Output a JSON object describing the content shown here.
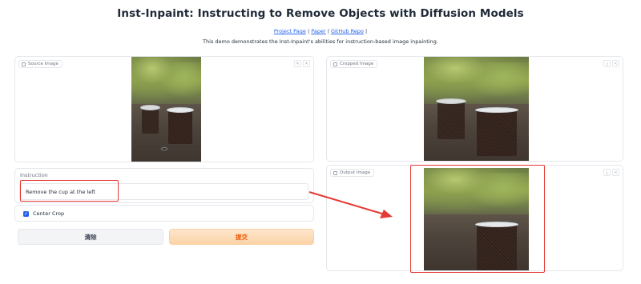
{
  "header": {
    "title": "Inst-Inpaint: Instructing to Remove Objects with Diffusion Models",
    "links": {
      "project_page": "Project Page",
      "sep1": " | ",
      "paper": "Paper",
      "sep2": " | ",
      "github": "GitHub Repo",
      "sep3": " |"
    },
    "description": "This demo demonstrates the Inst-Inpaint's abilities for instruction-based image inpainting."
  },
  "source_panel": {
    "label": "Source Image",
    "tools": [
      "edit-icon",
      "close-icon"
    ],
    "edit_glyph": "✎",
    "close_glyph": "✕"
  },
  "instruction": {
    "label": "Instruction",
    "value": "Remove the cup at the left"
  },
  "center_crop": {
    "label": "Center Crop",
    "checked": true,
    "check_glyph": "✓"
  },
  "buttons": {
    "clear": "清除",
    "submit": "提交"
  },
  "cropped_panel": {
    "label": "Cropped Image",
    "download_glyph": "⤓",
    "share_glyph": "<"
  },
  "output_panel": {
    "label": "Output Image",
    "download_glyph": "⤓",
    "share_glyph": "<"
  },
  "colors": {
    "annotation": "#e53935",
    "submit_text": "#ea580c",
    "link": "#2563eb",
    "checkbox": "#2563eb"
  }
}
